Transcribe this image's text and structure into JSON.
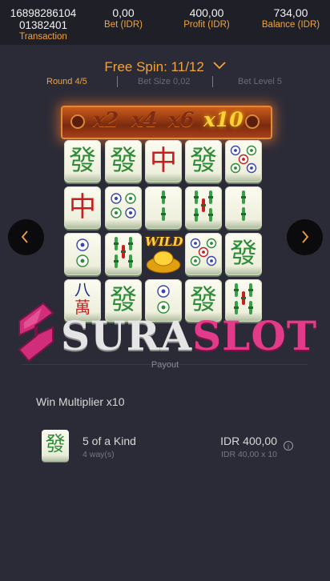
{
  "header": {
    "transaction_id_line1": "16898286104",
    "transaction_id_line2": "01382401",
    "transaction_label": "Transaction",
    "bet_value": "0,00",
    "bet_label": "Bet (IDR)",
    "profit_value": "400,00",
    "profit_label": "Profit (IDR)",
    "balance_value": "734,00",
    "balance_label": "Balance (IDR)"
  },
  "free_spin": {
    "label": "Free Spin: 11/12",
    "round": "Round 4/5",
    "bet_size": "Bet Size 0,02",
    "bet_level": "Bet Level 5"
  },
  "multipliers": [
    {
      "label": "x2",
      "active": false
    },
    {
      "label": "x4",
      "active": false
    },
    {
      "label": "x6",
      "active": false
    },
    {
      "label": "x10",
      "active": true
    }
  ],
  "reels": [
    [
      "fa",
      "zhong",
      "two-circles",
      "eight-wan"
    ],
    [
      "fa",
      "four-circles",
      "four-bamboo",
      "fa"
    ],
    [
      "zhong",
      "two-bamboo",
      "wild",
      "two-circles"
    ],
    [
      "fa",
      "four-bamboo",
      "five-circles",
      "fa"
    ],
    [
      "five-circles",
      "two-bamboo",
      "fa",
      "four-bamboo"
    ]
  ],
  "tile_glyphs": {
    "fa": "發",
    "zhong": "中",
    "eight_wan_top": "八",
    "eight_wan_bottom": "萬",
    "wild": "WILD"
  },
  "logo": {
    "part1": "SURA",
    "part2": "SLOT"
  },
  "payout_label": "Payout",
  "win_multiplier": "Win Multiplier x10",
  "payline": {
    "symbol": "發",
    "kind": "5 of a Kind",
    "ways": "4 way(s)",
    "amount": "IDR 400,00",
    "calc": "IDR 40,00 x 10",
    "info_glyph": "i"
  },
  "colors": {
    "accent": "#f2a33b",
    "background": "#2b2b37",
    "header_bg": "#1f1f28",
    "fa_green": "#2e8b37",
    "zhong_red": "#c51f1f",
    "brand_pink": "#e23b8a"
  }
}
